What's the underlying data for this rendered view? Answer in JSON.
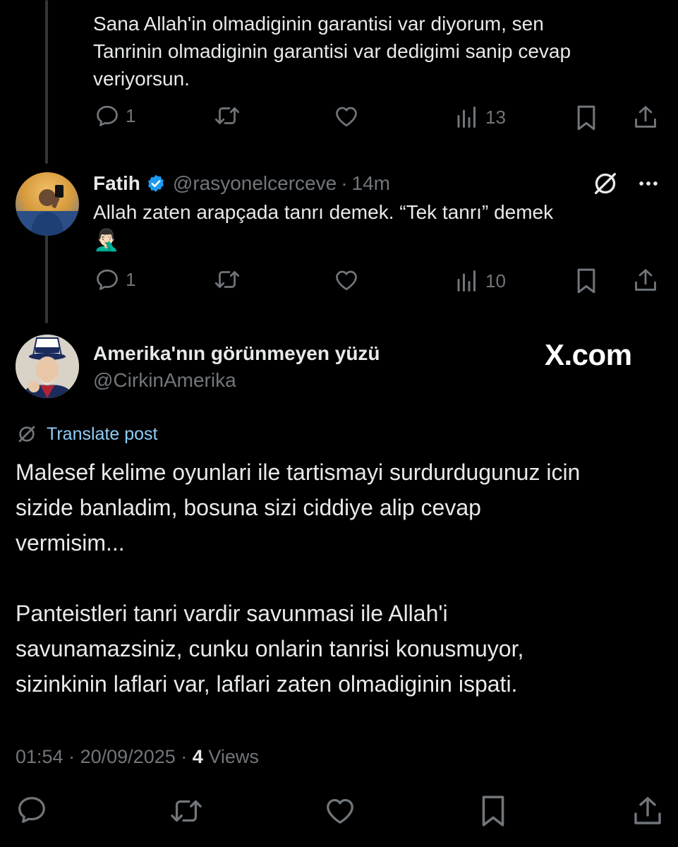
{
  "tweet1": {
    "text_lines": [
      "Sana Allah'in olmadiginin garantisi var diyorum, sen",
      "Tanrinin olmadiginin garantisi var dedigimi sanip cevap",
      "veriyorsun."
    ],
    "actions": {
      "replies": "1",
      "views": "13"
    }
  },
  "tweet2": {
    "name": "Fatih",
    "handle": "@rasyonelcerceve",
    "separator": "·",
    "time": "14m",
    "text_line1": "Allah zaten arapçada tanrı demek. “Tek tanrı” demek",
    "emoji": "🤦🏻‍♂️",
    "actions": {
      "replies": "1",
      "views": "10"
    }
  },
  "main": {
    "name": "Amerika'nın görünmeyen yüzü",
    "handle": "@CirkinAmerika",
    "watermark": "X.com",
    "translate": "Translate post",
    "paragraph1": [
      "Malesef kelime oyunlari ile tartismayi surdurdugunuz icin",
      "sizide banladim, bosuna sizi ciddiye alip cevap",
      "vermisim..."
    ],
    "paragraph2": [
      "Panteistleri tanri vardir savunmasi ile Allah'i",
      "savunamazsiniz, cunku onlarin tanrisi konusmuyor,",
      "sizinkinin laflari var, laflari zaten olmadiginin ispati."
    ],
    "meta": {
      "time": "01:54",
      "date": "20/09/2025",
      "views_count": "4",
      "views_label": "Views",
      "sep": "·"
    }
  },
  "colors": {
    "bg": "#000000",
    "text": "#e7e9ea",
    "muted": "#71767b",
    "link": "#8ecdf8",
    "verified": "#1d9bf0"
  },
  "icons": [
    "reply-icon",
    "retweet-icon",
    "like-icon",
    "views-icon",
    "bookmark-icon",
    "share-icon",
    "verified-badge-icon",
    "grok-icon",
    "more-icon",
    "translate-icon"
  ]
}
